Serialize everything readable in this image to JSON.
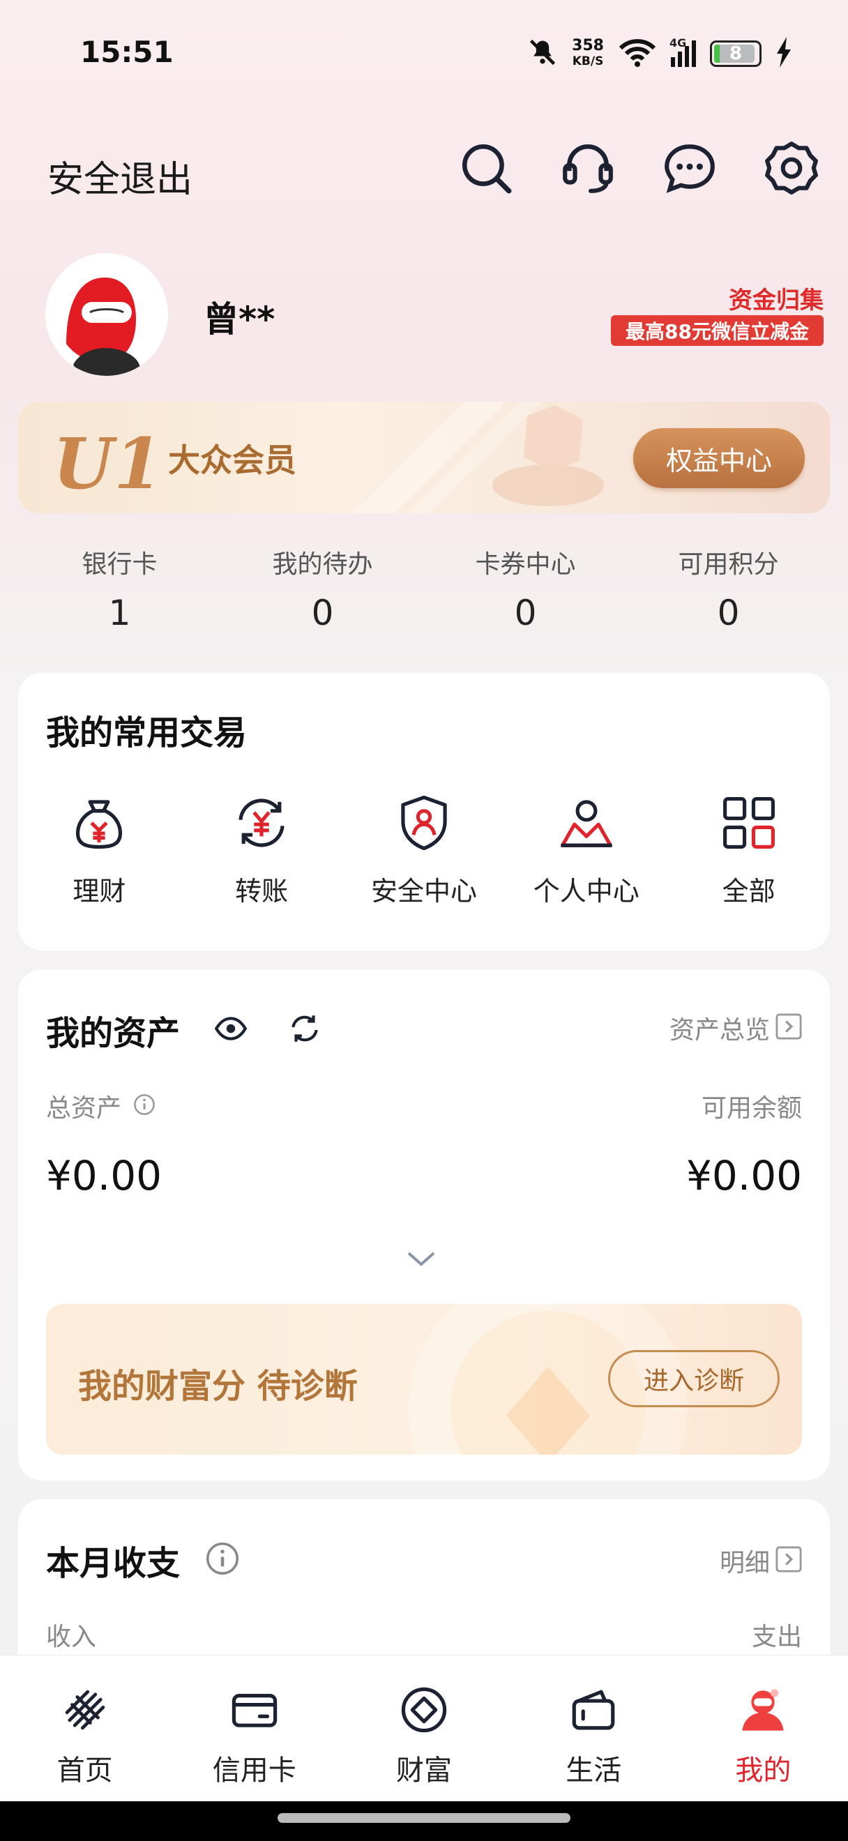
{
  "status_bar": {
    "time": "15:51",
    "net_speed": "358",
    "net_unit": "KB/S",
    "network": "4G",
    "battery": "8"
  },
  "header": {
    "logout_label": "安全退出",
    "icons": [
      "search-icon",
      "headset-icon",
      "message-icon",
      "settings-icon"
    ]
  },
  "profile": {
    "name": "曾**",
    "promo_line1": "资金归集",
    "promo_line2": "最高88元微信立减金"
  },
  "membership": {
    "level": "U1",
    "name": "大众会员",
    "button": "权益中心"
  },
  "stats": [
    {
      "label": "银行卡",
      "value": "1"
    },
    {
      "label": "我的待办",
      "value": "0"
    },
    {
      "label": "卡券中心",
      "value": "0"
    },
    {
      "label": "可用积分",
      "value": "0"
    }
  ],
  "quick": {
    "title": "我的常用交易",
    "items": [
      {
        "label": "理财",
        "icon": "money-bag-icon"
      },
      {
        "label": "转账",
        "icon": "transfer-icon"
      },
      {
        "label": "安全中心",
        "icon": "shield-user-icon"
      },
      {
        "label": "个人中心",
        "icon": "person-icon"
      },
      {
        "label": "全部",
        "icon": "grid-icon"
      }
    ]
  },
  "assets": {
    "title": "我的资产",
    "overview": "资产总览",
    "total_label": "总资产",
    "total_value": "¥0.00",
    "available_label": "可用余额",
    "available_value": "¥0.00",
    "wealth_text": "我的财富分  待诊断",
    "wealth_button": "进入诊断"
  },
  "monthly": {
    "title": "本月收支",
    "detail": "明细",
    "income_label": "收入",
    "expense_label": "支出"
  },
  "tabs": [
    {
      "label": "首页",
      "icon": "home-logo-icon",
      "active": false
    },
    {
      "label": "信用卡",
      "icon": "credit-card-icon",
      "active": false
    },
    {
      "label": "财富",
      "icon": "diamond-icon",
      "active": false
    },
    {
      "label": "生活",
      "icon": "wallet-icon",
      "active": false
    },
    {
      "label": "我的",
      "icon": "user-icon",
      "active": true
    }
  ],
  "colors": {
    "accent_red": "#e0242b",
    "gold": "#c9874d"
  }
}
